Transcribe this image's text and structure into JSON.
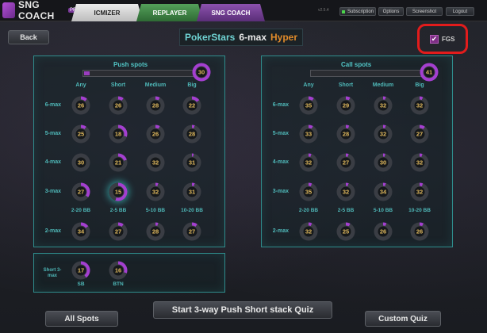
{
  "app": {
    "logo_text": "SNG COACH",
    "logo_badge": "PRO",
    "version": "v2.5.4"
  },
  "tabs": [
    "ICMIZER",
    "REPLAYER",
    "SNG COACH"
  ],
  "top_buttons": {
    "subscription": "Subscription",
    "options": "Options",
    "screenshot": "Screenshot",
    "logout": "Logout"
  },
  "header": {
    "back": "Back",
    "site": "PokerStars",
    "format": "6-max",
    "speed": "Hyper",
    "fgs_label": "FGS",
    "fgs_checked": "✔"
  },
  "push": {
    "title": "Push spots",
    "total": "30",
    "progress": 0.05,
    "columns": [
      "Any",
      "Short",
      "Medium",
      "Big"
    ],
    "rows": [
      {
        "label": "6-max",
        "values": [
          "26",
          "26",
          "28",
          "22"
        ],
        "pct": [
          0.12,
          0.1,
          0.08,
          0.15
        ]
      },
      {
        "label": "5-max",
        "values": [
          "25",
          "18",
          "26",
          "28"
        ],
        "pct": [
          0.1,
          0.3,
          0.08,
          0.05
        ]
      },
      {
        "label": "4-max",
        "values": [
          "30",
          "21",
          "32",
          "31"
        ],
        "pct": [
          0.0,
          0.2,
          0.0,
          0.03
        ]
      },
      {
        "label": "3-max",
        "values": [
          "27",
          "15",
          "32",
          "31"
        ],
        "pct": [
          0.35,
          0.55,
          0.05,
          0.05
        ]
      }
    ],
    "bb_labels": [
      "2-20 BB",
      "2-5 BB",
      "5-10 BB",
      "10-20 BB"
    ],
    "twomax": {
      "label": "2-max",
      "values": [
        "34",
        "27",
        "28",
        "27"
      ],
      "pct": [
        0.15,
        0.1,
        0.05,
        0.1
      ]
    }
  },
  "call": {
    "title": "Call spots",
    "total": "41",
    "progress": 0.0,
    "columns": [
      "Any",
      "Short",
      "Medium",
      "Big"
    ],
    "rows": [
      {
        "label": "6-max",
        "values": [
          "35",
          "29",
          "32",
          "32"
        ],
        "pct": [
          0.1,
          0.08,
          0.05,
          0.06
        ]
      },
      {
        "label": "5-max",
        "values": [
          "33",
          "28",
          "32",
          "27"
        ],
        "pct": [
          0.08,
          0.06,
          0.05,
          0.1
        ]
      },
      {
        "label": "4-max",
        "values": [
          "32",
          "27",
          "30",
          "32"
        ],
        "pct": [
          0.05,
          0.05,
          0.04,
          0.05
        ]
      },
      {
        "label": "3-max",
        "values": [
          "35",
          "32",
          "34",
          "32"
        ],
        "pct": [
          0.06,
          0.05,
          0.05,
          0.06
        ]
      }
    ],
    "bb_labels": [
      "2-20 BB",
      "2-5 BB",
      "5-10 BB",
      "10-20 BB"
    ],
    "twomax": {
      "label": "2-max",
      "values": [
        "32",
        "25",
        "26",
        "26"
      ],
      "pct": [
        0.06,
        0.08,
        0.06,
        0.07
      ]
    }
  },
  "short": {
    "label": "Short 3-max",
    "items": [
      {
        "label": "SB",
        "value": "17",
        "pct": 0.4
      },
      {
        "label": "BTN",
        "value": "16",
        "pct": 0.3
      }
    ]
  },
  "bottom": {
    "all_spots": "All Spots",
    "quiz": "Start 3-way Push Short stack Quiz",
    "custom": "Custom Quiz"
  },
  "colors": {
    "accent": "#9a3dbf",
    "teal": "#2f8c8c",
    "value": "#e0b85c",
    "highlight": "#e21c1c"
  }
}
